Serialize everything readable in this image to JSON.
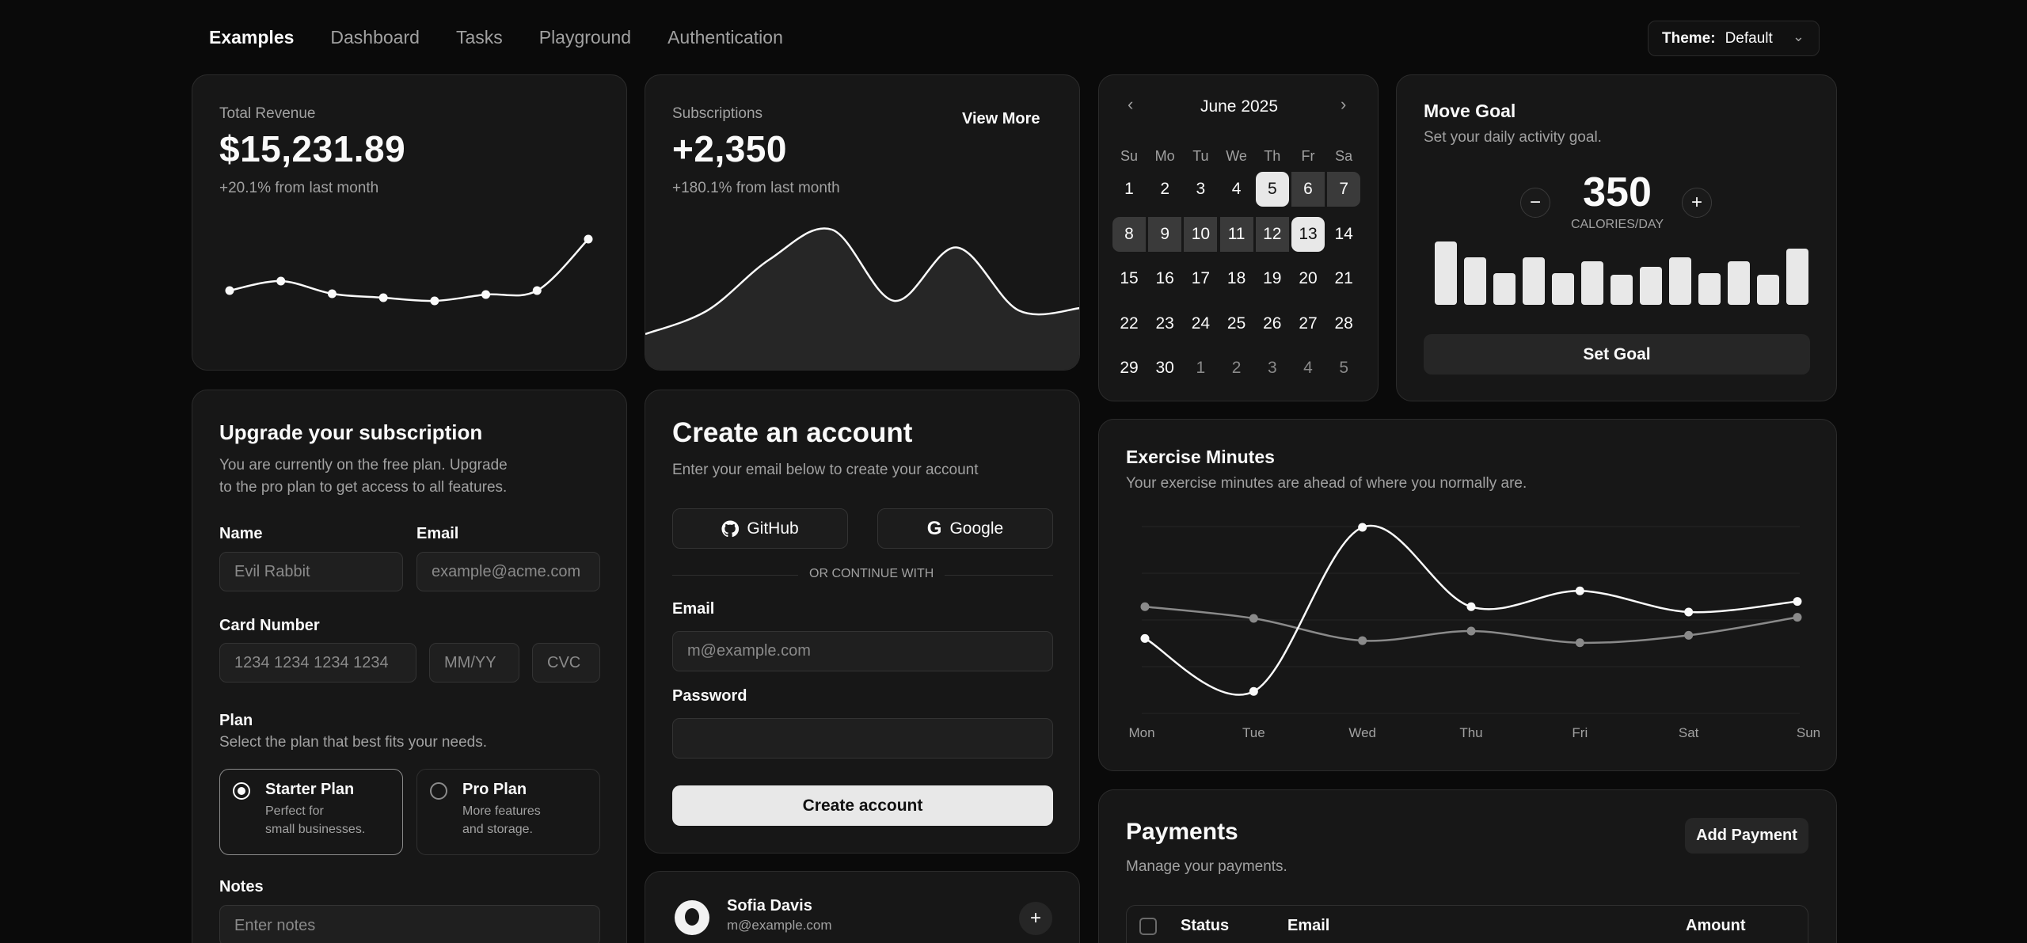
{
  "nav": {
    "items": [
      "Examples",
      "Dashboard",
      "Tasks",
      "Playground",
      "Authentication"
    ],
    "active": "Examples"
  },
  "theme": {
    "label": "Theme:",
    "value": "Default"
  },
  "revenue": {
    "title": "Total Revenue",
    "value": "$15,231.89",
    "change": "+20.1% from last month",
    "sparkline": [
      0.33,
      0.45,
      0.29,
      0.24,
      0.2,
      0.28,
      0.33,
      0.98
    ]
  },
  "subscriptions": {
    "title": "Subscriptions",
    "value": "+2,350",
    "change": "+180.1% from last month",
    "view_more": "View More",
    "area": [
      0.12,
      0.32,
      0.75,
      1.0,
      0.4,
      0.85,
      0.32,
      0.34
    ]
  },
  "calendar": {
    "month": "June 2025",
    "weekdays": [
      "Su",
      "Mo",
      "Tu",
      "We",
      "Th",
      "Fr",
      "Sa"
    ],
    "weeks": [
      [
        "1",
        "2",
        "3",
        "4",
        "5",
        "6",
        "7"
      ],
      [
        "8",
        "9",
        "10",
        "11",
        "12",
        "13",
        "14"
      ],
      [
        "15",
        "16",
        "17",
        "18",
        "19",
        "20",
        "21"
      ],
      [
        "22",
        "23",
        "24",
        "25",
        "26",
        "27",
        "28"
      ],
      [
        "29",
        "30",
        "1",
        "2",
        "3",
        "4",
        "5"
      ]
    ],
    "range_start": "5",
    "range_end": "13"
  },
  "goal": {
    "title": "Move Goal",
    "description": "Set your daily activity goal.",
    "value": "350",
    "unit": "CALORIES/DAY",
    "bars": [
      0.95,
      0.72,
      0.48,
      0.72,
      0.48,
      0.66,
      0.45,
      0.57,
      0.72,
      0.48,
      0.66,
      0.45,
      0.84
    ],
    "button": "Set Goal"
  },
  "exercise": {
    "title": "Exercise Minutes",
    "description": "Your exercise minutes are ahead of where you normally are.",
    "chart_data": {
      "type": "line",
      "categories": [
        "Mon",
        "Tue",
        "Wed",
        "Thu",
        "Fri",
        "Sat",
        "Sun"
      ],
      "series": [
        {
          "values": [
            240,
            140,
            450,
            300,
            330,
            290,
            310
          ]
        },
        {
          "values": [
            300,
            278,
            236,
            254,
            232,
            246,
            280
          ]
        }
      ],
      "ylim": [
        100,
        450
      ],
      "grid": true
    }
  },
  "subscription": {
    "title": "Upgrade your subscription",
    "description_1": "You are currently on the free plan. Upgrade",
    "description_2": "to the pro plan to get access to all features.",
    "name_label": "Name",
    "name_placeholder": "Evil Rabbit",
    "email_label": "Email",
    "email_placeholder": "example@acme.com",
    "card_label": "Card Number",
    "card_placeholder": "1234 1234 1234 1234",
    "expiry_placeholder": "MM/YY",
    "cvc_placeholder": "CVC",
    "plan_label": "Plan",
    "plan_description": "Select the plan that best fits your needs.",
    "plans": [
      {
        "name": "Starter Plan",
        "line1": "Perfect for",
        "line2": "small businesses."
      },
      {
        "name": "Pro Plan",
        "line1": "More features",
        "line2": "and storage."
      }
    ],
    "notes_label": "Notes",
    "notes_placeholder": "Enter notes"
  },
  "account": {
    "title": "Create an account",
    "description": "Enter your email below to create your account",
    "github": "GitHub",
    "google": "Google",
    "divider": "OR CONTINUE WITH",
    "email_label": "Email",
    "email_placeholder": "m@example.com",
    "password_label": "Password",
    "button": "Create account"
  },
  "team": {
    "name": "Sofia Davis",
    "email": "m@example.com"
  },
  "payments": {
    "title": "Payments",
    "description": "Manage your payments.",
    "add_button": "Add Payment",
    "columns": [
      "Status",
      "Email",
      "Amount"
    ]
  }
}
